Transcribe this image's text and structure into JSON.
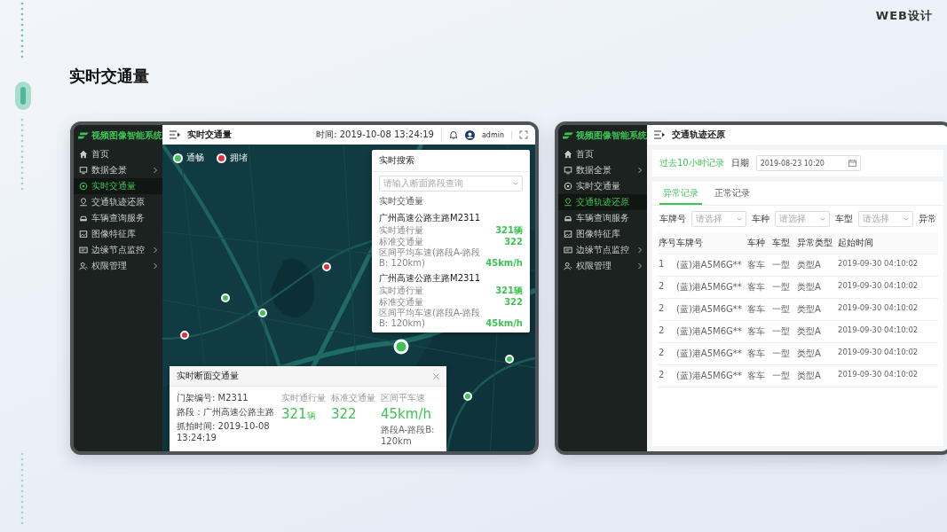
{
  "page": {
    "tag": "WEB设计",
    "title": "实时交通量"
  },
  "left_screen": {
    "app_name": "视频图像智能系统",
    "page_title": "实时交通量",
    "time": "时间: 2019-10-08 13:24:19",
    "user": "admin",
    "sidebar": [
      {
        "label": "首页",
        "expandable": false,
        "selected": false
      },
      {
        "label": "数据全景",
        "expandable": true,
        "selected": false
      },
      {
        "label": "实时交通量",
        "expandable": false,
        "selected": true
      },
      {
        "label": "交通轨迹还原",
        "expandable": false,
        "selected": false
      },
      {
        "label": "车辆查询服务",
        "expandable": false,
        "selected": false
      },
      {
        "label": "图像特征库",
        "expandable": false,
        "selected": false
      },
      {
        "label": "边缘节点监控",
        "expandable": true,
        "selected": false
      },
      {
        "label": "权限管理",
        "expandable": true,
        "selected": false
      }
    ],
    "legend": [
      {
        "label": "通畅",
        "color": "#3ec155"
      },
      {
        "label": "拥堵",
        "color": "#e0303a"
      }
    ],
    "markers": [
      {
        "color": "#3ec155",
        "selected": false
      },
      {
        "color": "#e0303a",
        "selected": false
      },
      {
        "color": "#e0303a",
        "selected": false
      },
      {
        "color": "#3ec155",
        "selected": true
      },
      {
        "color": "#3ec155",
        "selected": false
      },
      {
        "color": "#3ec155",
        "selected": false
      },
      {
        "color": "#3ec155",
        "selected": false
      }
    ],
    "search_panel": {
      "title": "实时搜索",
      "placeholder": "请输入断面路段查询",
      "section": "实时交通量",
      "entries": [
        {
          "road": "广州高速公路主路M2311",
          "rows": [
            {
              "label": "实时通行量",
              "value": "321辆"
            },
            {
              "label": "标准交通量",
              "value": "322"
            },
            {
              "label": "区间平均车速(路段A-路段B: 120km)",
              "value": "45km/h"
            }
          ]
        },
        {
          "road": "广州高速公路主路M2311",
          "rows": [
            {
              "label": "实时通行量",
              "value": "321辆"
            },
            {
              "label": "标准交通量",
              "value": "322"
            },
            {
              "label": "区间平均车速(路段A-路段B: 120km)",
              "value": "45km/h"
            }
          ]
        }
      ]
    },
    "detail_popup": {
      "title": "实时断面交通量",
      "info": [
        "门架编号: M2311",
        "路段：广州高速公路主路",
        "抓拍时间: 2019-10-08 13:24:19"
      ],
      "stats": [
        {
          "label": "实时通行量",
          "value": "321",
          "unit": "辆"
        },
        {
          "label": "标准交通量",
          "value": "322"
        },
        {
          "label": "区间平车速",
          "value": "45km/h",
          "note": "路段A-路段B: 120km"
        }
      ]
    }
  },
  "right_screen": {
    "app_name": "视频图像智能系统",
    "page_title": "交通轨迹还原",
    "sidebar": [
      {
        "label": "首页",
        "expandable": false,
        "selected": false
      },
      {
        "label": "数据全景",
        "expandable": true,
        "selected": false
      },
      {
        "label": "实时交通量",
        "expandable": false,
        "selected": false
      },
      {
        "label": "交通轨迹还原",
        "expandable": false,
        "selected": true
      },
      {
        "label": "车辆查询服务",
        "expandable": false,
        "selected": false
      },
      {
        "label": "图像特征库",
        "expandable": false,
        "selected": false
      },
      {
        "label": "边缘节点监控",
        "expandable": true,
        "selected": false
      },
      {
        "label": "权限管理",
        "expandable": true,
        "selected": false
      }
    ],
    "history_link": "过去10小时记录",
    "date_label": "日期",
    "date_value": "2019-08-23 10:20",
    "tabs": [
      {
        "label": "异常记录",
        "selected": true
      },
      {
        "label": "正常记录",
        "selected": false
      }
    ],
    "filters": [
      {
        "label": "车牌号",
        "placeholder": "请选择"
      },
      {
        "label": "车种",
        "placeholder": "请选择"
      },
      {
        "label": "车型",
        "placeholder": "请选择"
      }
    ],
    "filter_cut_label": "异常",
    "table": {
      "columns": [
        "序号",
        "车牌号",
        "车种",
        "车型",
        "异常类型",
        "起始时间"
      ],
      "rows": [
        [
          "1",
          "(蓝)港A5M6G**",
          "客车",
          "一型",
          "类型A",
          "2019-09-30  04:10:02"
        ],
        [
          "2",
          "(蓝)港A5M6G**",
          "客车",
          "一型",
          "类型A",
          "2019-09-30  04:10:02"
        ],
        [
          "2",
          "(蓝)港A5M6G**",
          "客车",
          "一型",
          "类型A",
          "2019-09-30  04:10:02"
        ],
        [
          "2",
          "(蓝)港A5M6G**",
          "客车",
          "一型",
          "类型A",
          "2019-09-30  04:10:02"
        ],
        [
          "2",
          "(蓝)港A5M6G**",
          "客车",
          "一型",
          "类型A",
          "2019-09-30  04:10:02"
        ],
        [
          "2",
          "(蓝)港A5M6G**",
          "客车",
          "一型",
          "类型A",
          "2019-09-30  04:10:02"
        ]
      ]
    }
  }
}
